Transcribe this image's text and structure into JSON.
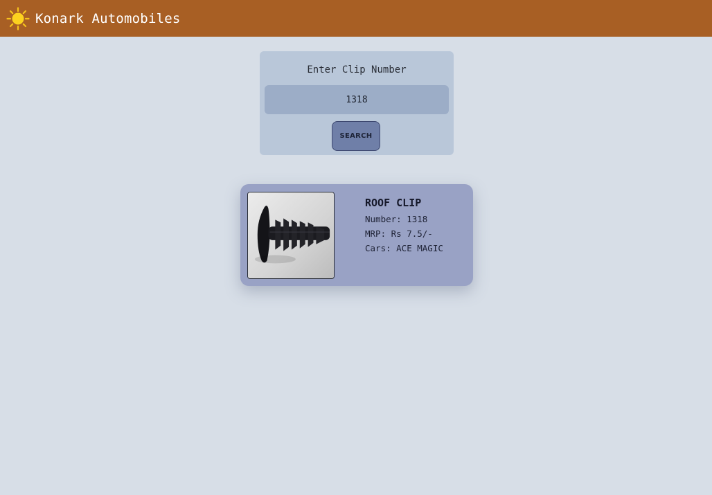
{
  "header": {
    "logo_icon": "sun-icon",
    "brand": "Konark Automobiles",
    "bg_color": "#a85f24"
  },
  "search": {
    "label": "Enter Clip Number",
    "value": "1318",
    "button_label": "SEARCH"
  },
  "result": {
    "image_icon": "roof-clip-photo",
    "title": "ROOF CLIP",
    "number_line": "Number: 1318",
    "mrp_line": "MRP: Rs 7.5/-",
    "cars_line": "Cars: ACE MAGIC"
  }
}
